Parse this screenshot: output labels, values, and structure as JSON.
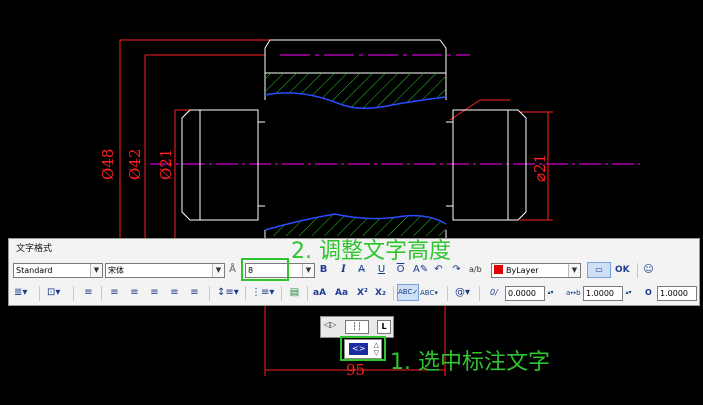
{
  "drawing": {
    "dims": {
      "d48": "Ø48",
      "d42": "Ø42",
      "d21_left": "Ø21",
      "d21_right": "⌀21",
      "len95": "95"
    },
    "colors": {
      "outline": "#ffffff",
      "dim": "#ff2020",
      "center": "#ff00ff",
      "hatch": "#22cc22",
      "break": "#2a4cff"
    }
  },
  "toolbar": {
    "title": "文字格式",
    "style_value": "Standard",
    "font_value": "宋体",
    "height_value": "8",
    "color_value": "ByLayer",
    "color_swatch": "#e00000",
    "ok_label": "OK",
    "oblique_value": "0.0000",
    "tracking_value": "1.0000",
    "width_value": "1.0000",
    "icons_row1": {
      "bold": "B",
      "italic": "I",
      "underline": "U",
      "overline": "O",
      "annotative": "A"
    },
    "icons_row2": {
      "superscript": "X²",
      "subscript": "X₂",
      "uppercase": "aA",
      "lowercase": "Aa",
      "tracking_label": "a↔b"
    }
  },
  "annotations": {
    "step2": "2. 调整文字高度",
    "step1": "1. 选中标注文字"
  },
  "editor": {
    "selected_text": "<>",
    "tabs_left": "◁▷",
    "tab_mark": "L"
  }
}
